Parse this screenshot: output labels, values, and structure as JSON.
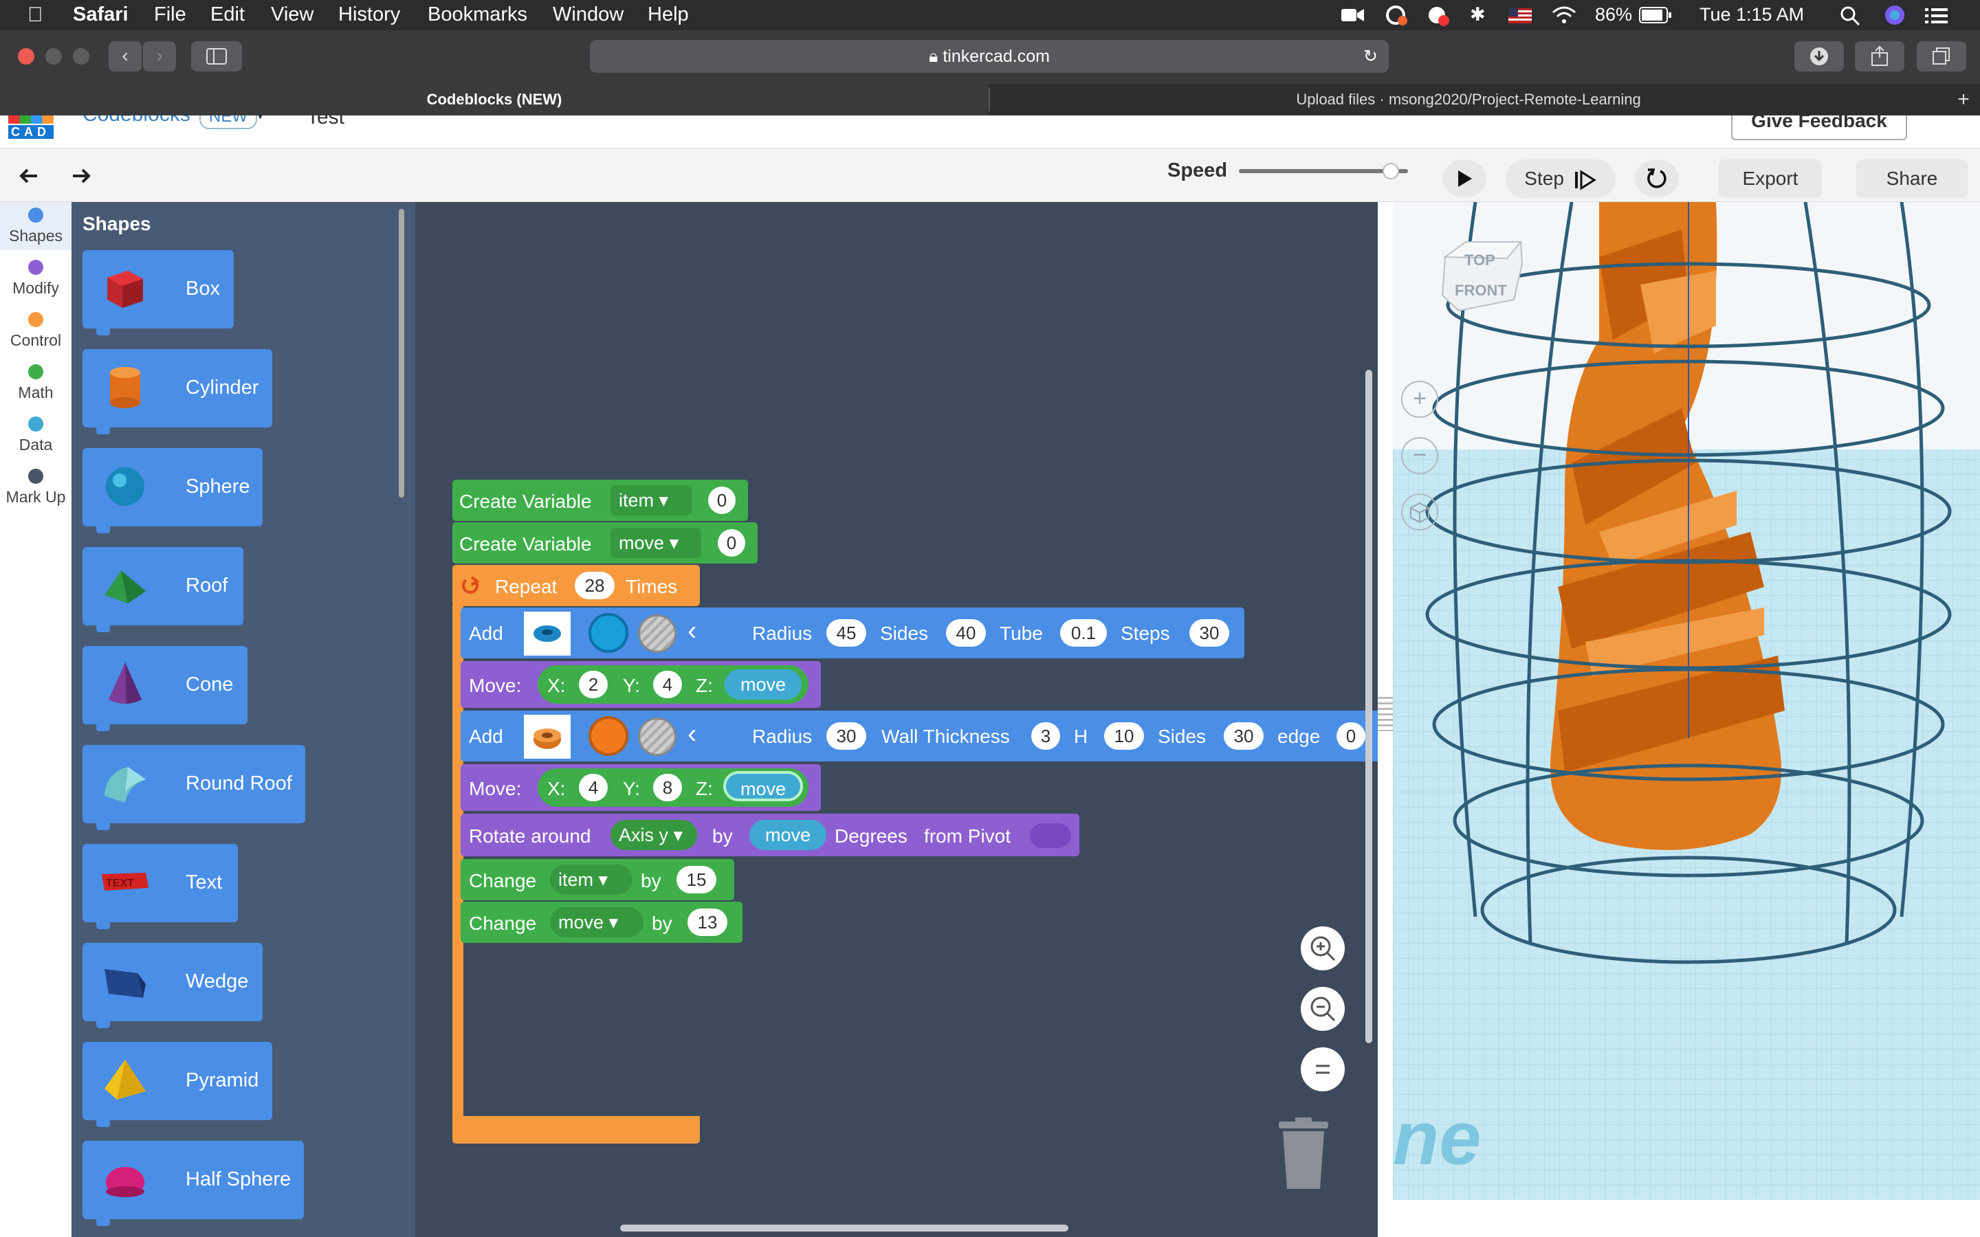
{
  "menubar": {
    "apple": "",
    "app": "Safari",
    "items": [
      "File",
      "Edit",
      "View",
      "History",
      "Bookmarks",
      "Window",
      "Help"
    ],
    "battery": "86%",
    "clock": "Tue 1:15 AM"
  },
  "browser": {
    "url": "tinkercad.com",
    "tabs": [
      "Codeblocks (NEW)",
      "Upload files · msong2020/Project-Remote-Learning"
    ]
  },
  "header": {
    "logo_letters": "CAD",
    "app_name": "Codeblocks",
    "badge": "NEW",
    "project": "Test",
    "feedback": "Give Feedback"
  },
  "toolbar": {
    "speed_label": "Speed",
    "speed_fraction": 0.9,
    "step_label": "Step",
    "export_label": "Export",
    "share_label": "Share"
  },
  "categories": [
    {
      "label": "Shapes",
      "color": "#4a8ee6"
    },
    {
      "label": "Modify",
      "color": "#8e5fd1"
    },
    {
      "label": "Control",
      "color": "#f79a3e"
    },
    {
      "label": "Math",
      "color": "#3fae4a"
    },
    {
      "label": "Data",
      "color": "#3fa9d4"
    },
    {
      "label": "Mark Up",
      "color": "#4a5568"
    }
  ],
  "flyout": {
    "title": "Shapes",
    "shapes": [
      {
        "label": "Box",
        "icon": "box-icon"
      },
      {
        "label": "Cylinder",
        "icon": "cylinder-icon"
      },
      {
        "label": "Sphere",
        "icon": "sphere-icon"
      },
      {
        "label": "Roof",
        "icon": "roof-icon"
      },
      {
        "label": "Cone",
        "icon": "cone-icon"
      },
      {
        "label": "Round Roof",
        "icon": "round-roof-icon"
      },
      {
        "label": "Text",
        "icon": "text-icon"
      },
      {
        "label": "Wedge",
        "icon": "wedge-icon"
      },
      {
        "label": "Pyramid",
        "icon": "pyramid-icon"
      },
      {
        "label": "Half Sphere",
        "icon": "half-sphere-icon"
      }
    ]
  },
  "blocks": {
    "var1": {
      "label": "Create Variable",
      "name": "item",
      "value": "0"
    },
    "var2": {
      "label": "Create Variable",
      "name": "move",
      "value": "0"
    },
    "repeat": {
      "label": "Repeat",
      "count": "28",
      "suffix": "Times"
    },
    "add1": {
      "label": "Add",
      "radius_label": "Radius",
      "radius": "45",
      "sides_label": "Sides",
      "sides": "40",
      "tube_label": "Tube",
      "tube": "0.1",
      "steps_label": "Steps",
      "steps": "30"
    },
    "move1": {
      "label": "Move:",
      "x_label": "X:",
      "x": "2",
      "y_label": "Y:",
      "y": "4",
      "z_label": "Z:",
      "z": "move"
    },
    "add2": {
      "label": "Add",
      "radius_label": "Radius",
      "radius": "30",
      "wall_label": "Wall Thickness",
      "wall": "3",
      "h_label": "H",
      "h": "10",
      "sides_label": "Sides",
      "sides": "30",
      "edge_label": "edge",
      "edge": "0"
    },
    "move2": {
      "label": "Move:",
      "x_label": "X:",
      "x": "4",
      "y_label": "Y:",
      "y": "8",
      "z_label": "Z:",
      "z": "move"
    },
    "rotate": {
      "label": "Rotate around",
      "axis": "Axis y",
      "by": "by",
      "var": "move",
      "degrees": "Degrees",
      "pivot": "from Pivot"
    },
    "change1": {
      "label": "Change",
      "name": "item",
      "by": "by",
      "value": "15"
    },
    "change2": {
      "label": "Change",
      "name": "move",
      "by": "by",
      "value": "13"
    }
  },
  "viewcube": {
    "top": "TOP",
    "front": "FRONT"
  },
  "watermark": "ne"
}
